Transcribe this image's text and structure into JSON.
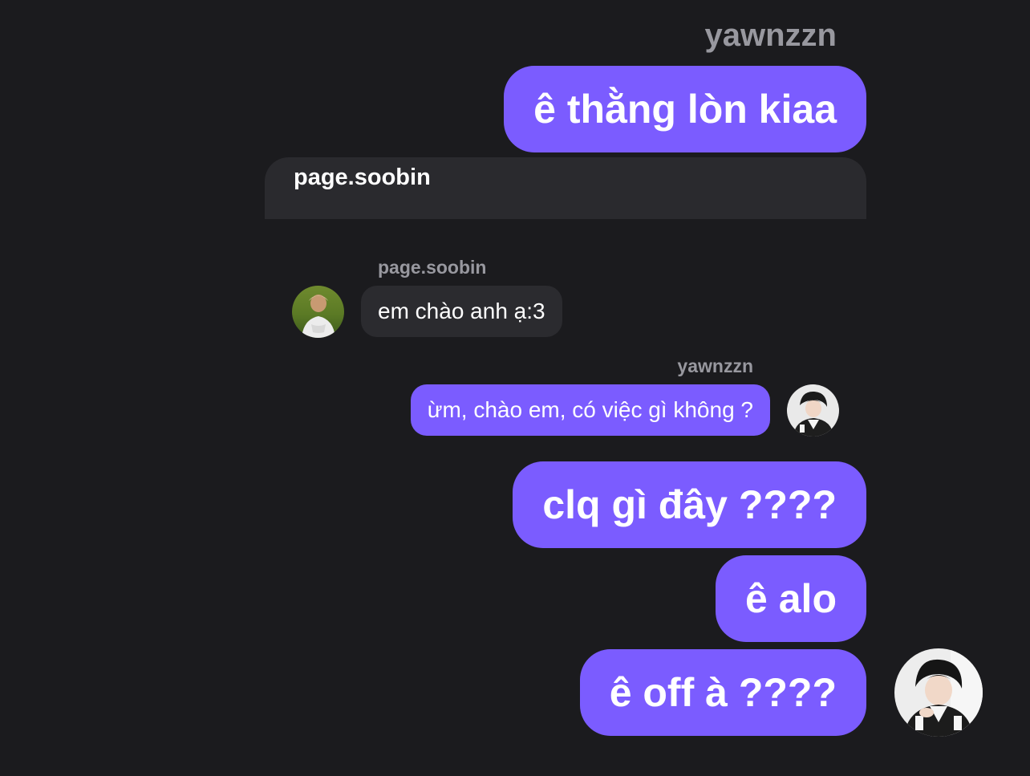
{
  "header": {
    "sender_name": "yawnzzn"
  },
  "messages_top": [
    {
      "text": "ê thằng lòn kiaa"
    }
  ],
  "reply_card": {
    "username": "page.soobin"
  },
  "embedded_chat": {
    "incoming": {
      "sender": "page.soobin",
      "text": "em chào anh ạ:3",
      "avatar_icon": "avatar-photo"
    },
    "outgoing": {
      "sender": "yawnzzn",
      "text": "ừm, chào em, có việc gì không ?",
      "avatar_icon": "avatar-photo"
    }
  },
  "messages_bottom": [
    {
      "text": "clq gì đây ????"
    },
    {
      "text": "ê alo"
    },
    {
      "text": "ê off à ????"
    }
  ],
  "colors": {
    "background": "#1b1b1e",
    "accent_bubble": "#7b5cff",
    "incoming_bubble": "#2b2b2f",
    "reply_card": "#2a2a2e",
    "muted_text": "#98989f"
  }
}
